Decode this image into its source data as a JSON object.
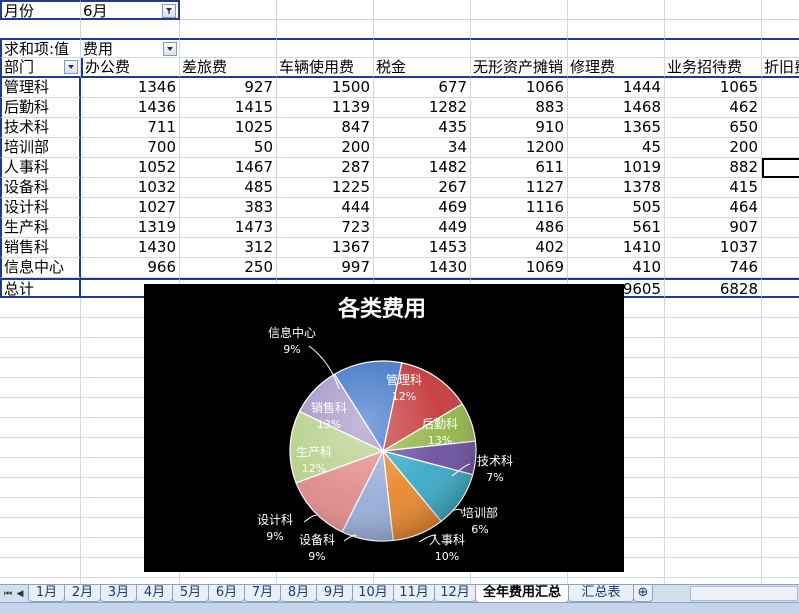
{
  "filter": {
    "label": "月份",
    "value": "6月"
  },
  "pivot": {
    "sum_label": "求和项:值",
    "field_label": "费用",
    "row_header": "部门",
    "columns": [
      "办公费",
      "差旅费",
      "车辆使用费",
      "税金",
      "无形资产摊销",
      "修理费",
      "业务招待费",
      "折旧费"
    ],
    "rows": [
      {
        "dept": "管理科",
        "values": [
          "1346",
          "927",
          "1500",
          "677",
          "1066",
          "1444",
          "1065"
        ]
      },
      {
        "dept": "后勤科",
        "values": [
          "1436",
          "1415",
          "1139",
          "1282",
          "883",
          "1468",
          "462"
        ]
      },
      {
        "dept": "技术科",
        "values": [
          "711",
          "1025",
          "847",
          "435",
          "910",
          "1365",
          "650"
        ]
      },
      {
        "dept": "培训部",
        "values": [
          "700",
          "50",
          "200",
          "34",
          "1200",
          "45",
          "200"
        ]
      },
      {
        "dept": "人事科",
        "values": [
          "1052",
          "1467",
          "287",
          "1482",
          "611",
          "1019",
          "882"
        ]
      },
      {
        "dept": "设备科",
        "values": [
          "1032",
          "485",
          "1225",
          "267",
          "1127",
          "1378",
          "415"
        ]
      },
      {
        "dept": "设计科",
        "values": [
          "1027",
          "383",
          "444",
          "469",
          "1116",
          "505",
          "464"
        ]
      },
      {
        "dept": "生产科",
        "values": [
          "1319",
          "1473",
          "723",
          "449",
          "486",
          "561",
          "907"
        ]
      },
      {
        "dept": "销售科",
        "values": [
          "1430",
          "312",
          "1367",
          "1453",
          "402",
          "1410",
          "1037"
        ]
      },
      {
        "dept": "信息中心",
        "values": [
          "966",
          "250",
          "997",
          "1430",
          "1069",
          "410",
          "746"
        ]
      }
    ],
    "total": {
      "label": "总计",
      "values": [
        "",
        "",
        "",
        "",
        "",
        "9605",
        "6828"
      ]
    }
  },
  "chart_data": {
    "type": "pie",
    "title": "各类费用",
    "categories": [
      "管理科",
      "后勤科",
      "技术科",
      "培训部",
      "人事科",
      "设备科",
      "设计科",
      "生产科",
      "销售科",
      "信息中心"
    ],
    "values": [
      12,
      13,
      7,
      6,
      10,
      9,
      9,
      12,
      13,
      9
    ],
    "labels": [
      "12%",
      "13%",
      "7%",
      "6%",
      "10%",
      "9%",
      "9%",
      "12%",
      "13%",
      "9%"
    ],
    "colors": [
      "#3f74c8",
      "#c5383a",
      "#93b648",
      "#6b4fa0",
      "#3aa9c7",
      "#e8862c",
      "#97acd7",
      "#df8b89",
      "#b7d08c",
      "#a596c6"
    ]
  },
  "sheets": {
    "tabs": [
      "1月",
      "2月",
      "3月",
      "4月",
      "5月",
      "6月",
      "7月",
      "8月",
      "9月",
      "10月",
      "11月",
      "12月",
      "全年费用汇总",
      "汇总表"
    ],
    "active": "全年费用汇总"
  }
}
